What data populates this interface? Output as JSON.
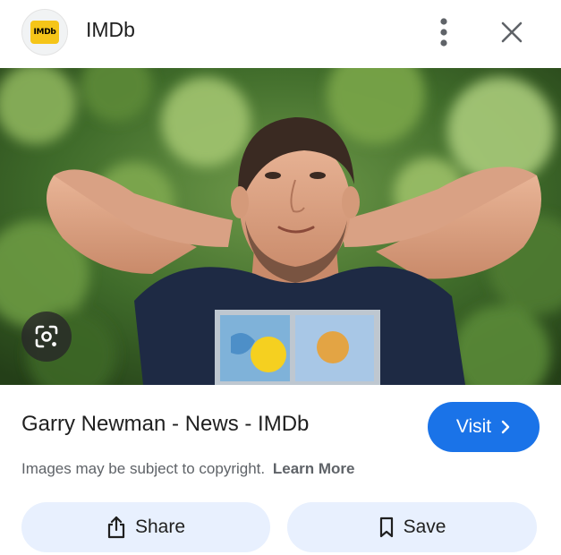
{
  "header": {
    "site_name": "IMDb",
    "logo_text": "IMDb",
    "more_icon": "more-vert-icon",
    "close_icon": "close-icon"
  },
  "image": {
    "lens_icon": "lens-icon"
  },
  "result": {
    "title": "Garry Newman - News - IMDb",
    "visit_label": "Visit",
    "visit_icon": "chevron-right-icon",
    "copyright_text": "Images may be subject to copyright.",
    "learn_more_label": "Learn More"
  },
  "actions": {
    "share_label": "Share",
    "share_icon": "share-icon",
    "save_label": "Save",
    "save_icon": "bookmark-icon"
  },
  "colors": {
    "accent": "#1a73e8",
    "imdb_yellow": "#f5c518",
    "action_bg": "#e8f0fe"
  }
}
